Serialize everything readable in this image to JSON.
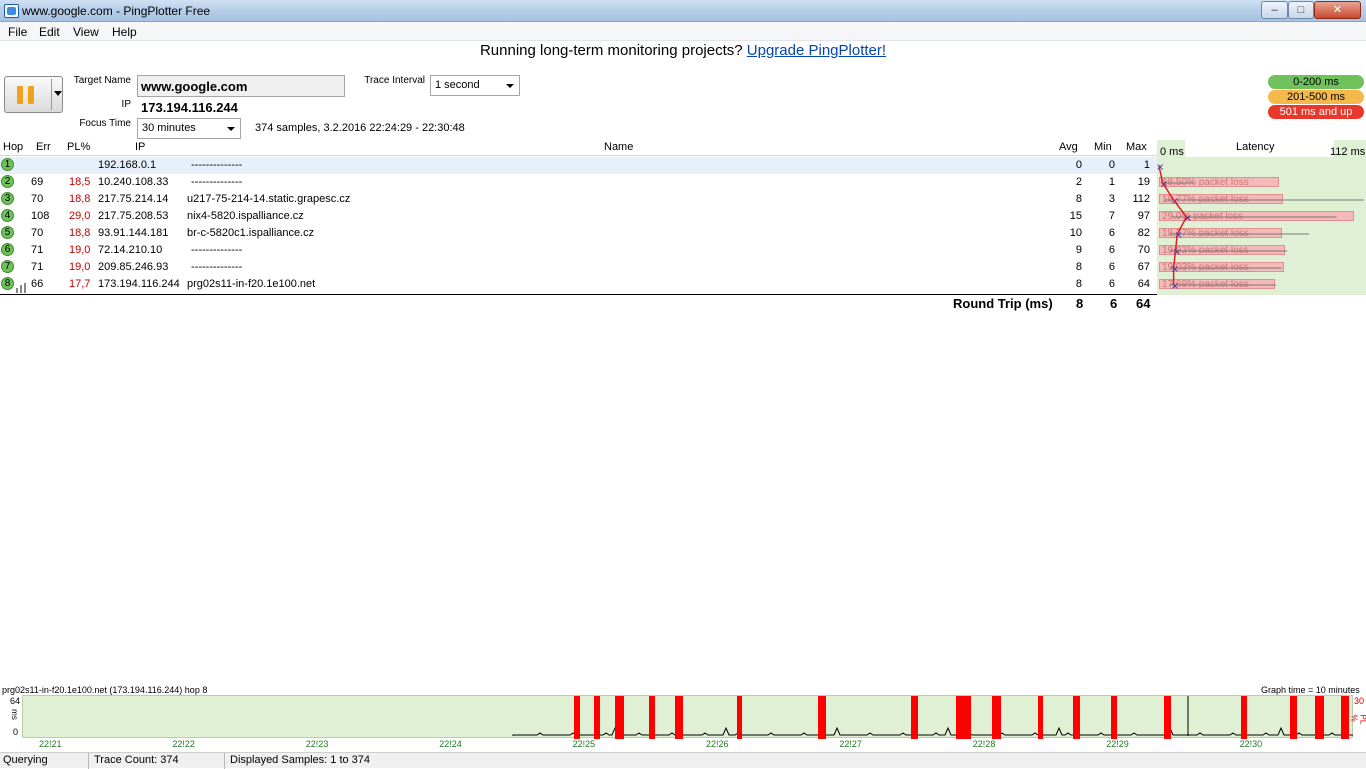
{
  "window": {
    "title": "www.google.com - PingPlotter Free"
  },
  "menu": [
    "File",
    "Edit",
    "View",
    "Help"
  ],
  "banner": {
    "text": "Running long-term monitoring projects?",
    "link": "Upgrade PingPlotter!"
  },
  "controls": {
    "target_label": "Target Name",
    "target_value": "www.google.com",
    "ip_label": "IP",
    "ip_value": "173.194.116.244",
    "focus_label": "Focus Time",
    "focus_value": "30 minutes",
    "interval_label": "Trace Interval",
    "interval_value": "1 second",
    "samples_info": "374 samples, 3.2.2016 22:24:29 - 22:30:48"
  },
  "legend": [
    {
      "label": "0-200 ms",
      "color": "#6ec15b"
    },
    {
      "label": "201-500 ms",
      "color": "#f5b84a"
    },
    {
      "label": "501 ms and up",
      "color": "#e8382c"
    }
  ],
  "table": {
    "headers": {
      "hop": "Hop",
      "err": "Err",
      "pl": "PL%",
      "ip": "IP",
      "name": "Name",
      "avg": "Avg",
      "min": "Min",
      "max": "Max"
    },
    "rows": [
      {
        "hop": "1",
        "err": "",
        "pl": "",
        "ip": "192.168.0.1",
        "name": "--------------",
        "avg": "0",
        "min": "0",
        "max": "1"
      },
      {
        "hop": "2",
        "err": "69",
        "pl": "18,5",
        "ip": "10.240.108.33",
        "name": "--------------",
        "avg": "2",
        "min": "1",
        "max": "19"
      },
      {
        "hop": "3",
        "err": "70",
        "pl": "18,8",
        "ip": "217.75.214.14",
        "name": "u217-75-214-14.static.grapesc.cz",
        "avg": "8",
        "min": "3",
        "max": "112"
      },
      {
        "hop": "4",
        "err": "108",
        "pl": "29,0",
        "ip": "217.75.208.53",
        "name": "nix4-5820.ispalliance.cz",
        "avg": "15",
        "min": "7",
        "max": "97"
      },
      {
        "hop": "5",
        "err": "70",
        "pl": "18,8",
        "ip": "93.91.144.181",
        "name": "br-c-5820c1.ispalliance.cz",
        "avg": "10",
        "min": "6",
        "max": "82"
      },
      {
        "hop": "6",
        "err": "71",
        "pl": "19,0",
        "ip": "72.14.210.10",
        "name": "--------------",
        "avg": "9",
        "min": "6",
        "max": "70"
      },
      {
        "hop": "7",
        "err": "71",
        "pl": "19,0",
        "ip": "209.85.246.93",
        "name": "--------------",
        "avg": "8",
        "min": "6",
        "max": "67"
      },
      {
        "hop": "8",
        "err": "66",
        "pl": "17,7",
        "ip": "173.194.116.244",
        "name": "prg02s11-in-f20.1e100.net",
        "avg": "8",
        "min": "6",
        "max": "64"
      }
    ],
    "round_trip": {
      "label": "Round Trip (ms)",
      "avg": "8",
      "min": "6",
      "max": "64"
    }
  },
  "latency": {
    "title": "Latency",
    "scale_min": "0 ms",
    "scale_max": "112 ms",
    "packet_loss": [
      "18,50% packet loss",
      "18,77% packet loss",
      "29,0% packet loss",
      "18,77% packet loss",
      "19,03% packet loss",
      "19,03% packet loss",
      "17,69% packet loss"
    ]
  },
  "graph": {
    "title": "prg02s11-in-f20.1e100.net (173.194.116.244) hop 8",
    "time_note": "Graph time = 10 minutes",
    "y_top": "64",
    "y_bottom": "0",
    "y_unit": "ms",
    "right_top": "30",
    "right_unit": "PL %",
    "time_labels": [
      "22!21",
      "22!22",
      "22!23",
      "22!24",
      "22!25",
      "22!26",
      "22!27",
      "22!28",
      "22!29",
      "22!30"
    ]
  },
  "status": {
    "state": "Querying",
    "trace_count": "Trace Count: 374",
    "displayed": "Displayed Samples: 1 to 374"
  }
}
